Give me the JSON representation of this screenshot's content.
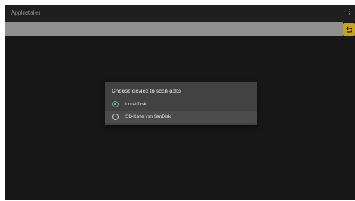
{
  "app": {
    "title": "AppInstaller"
  },
  "toolbar": {
    "overflow_icon": "vertical-dots-icon",
    "path_value": "",
    "back_icon": "undo-arrow-icon",
    "accent_color": "#c7a41a"
  },
  "dialog": {
    "title": "Choose device to scan apks",
    "options": [
      {
        "label": "Local Disk",
        "selected": true
      },
      {
        "label": "SD-Karte von SanDisk",
        "selected": false
      }
    ],
    "radio_accent_color": "#5fb3a3"
  }
}
